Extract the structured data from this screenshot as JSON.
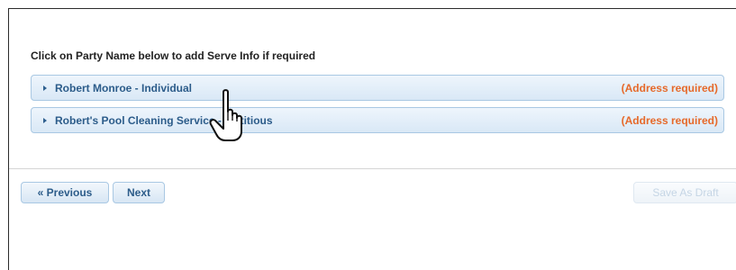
{
  "instruction": "Click on Party Name below to add Serve Info if required",
  "parties": [
    {
      "name": "Robert Monroe - Individual",
      "status": "(Address required)"
    },
    {
      "name": "Robert's Pool Cleaning Service - Fictitious",
      "status": "(Address required)"
    }
  ],
  "buttons": {
    "previous": "« Previous",
    "next": "Next",
    "save_draft": "Save As Draft"
  },
  "colors": {
    "link": "#2c5c8a",
    "warning": "#e6692a",
    "row_border": "#a9c8e3"
  },
  "icons": {
    "expand": "caret-right-icon",
    "pointer": "hand-cursor-icon"
  }
}
